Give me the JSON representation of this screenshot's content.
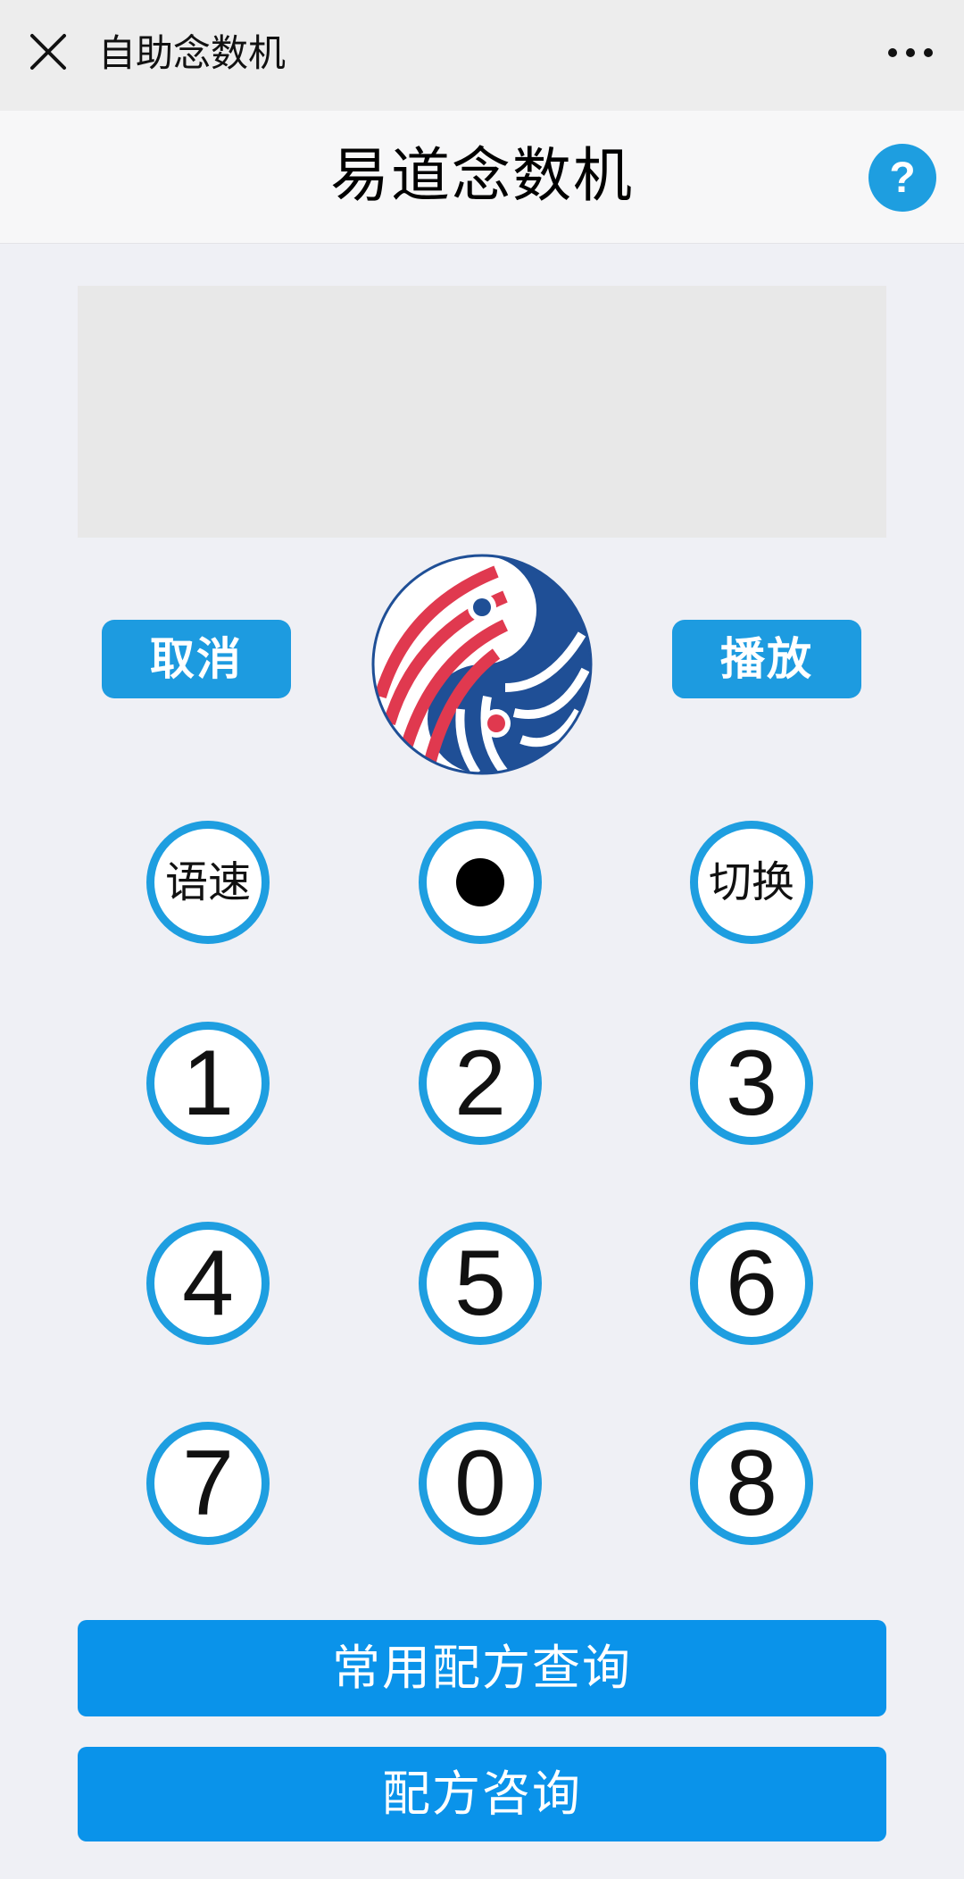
{
  "app": {
    "window_title": "自助念数机",
    "page_title": "易道念数机"
  },
  "controls": {
    "cancel_label": "取消",
    "play_label": "播放"
  },
  "keypad": {
    "speed_label": "语速",
    "switch_label": "切换",
    "digits": [
      "1",
      "2",
      "3",
      "4",
      "5",
      "6",
      "7",
      "0",
      "8"
    ]
  },
  "bottom": {
    "recipe_query_label": "常用配方查询",
    "recipe_consult_label": "配方咨询"
  },
  "colors": {
    "accent": "#1e9ee0",
    "button_blue": "#0a93ea",
    "logo_red": "#e0394f",
    "logo_navy": "#1f4f96"
  },
  "icons": {
    "close": "close-icon",
    "more": "more-icon",
    "help": "help-icon",
    "logo": "yin-yang-logo"
  }
}
